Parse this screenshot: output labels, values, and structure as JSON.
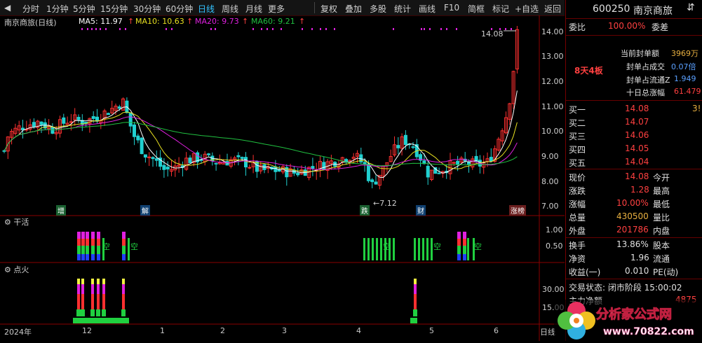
{
  "toolbar": {
    "periods": [
      "分时",
      "1分钟",
      "5分钟",
      "15分钟",
      "30分钟",
      "60分钟",
      "日线",
      "周线",
      "月线",
      "更多"
    ],
    "active_period": "日线",
    "tools": [
      "复权",
      "叠加",
      "多股",
      "统计",
      "画线",
      "F10",
      "简框",
      "标记",
      "+自选",
      "返回"
    ]
  },
  "main_legend": {
    "name": "南京商旅(日线)",
    "ma5": "MA5: 11.97",
    "ma10": "MA10: 10.63",
    "ma20": "MA20: 9.73",
    "ma60": "MA60: 9.21",
    "arrow": "↑"
  },
  "price_axis": [
    "14.00",
    "13.00",
    "12.00",
    "11.00",
    "10.00",
    "9.00",
    "8.00",
    "7.00"
  ],
  "annotations": {
    "high": "14.08",
    "low": "←7.12"
  },
  "event_tags": [
    "增",
    "解",
    "跌",
    "财",
    "涨榜"
  ],
  "panel2": {
    "title": "干活",
    "ticks": [
      "1.00",
      "0.50"
    ],
    "label": "空"
  },
  "panel3": {
    "title": "点火",
    "ticks": [
      "30.00",
      "15.00"
    ]
  },
  "time_axis": {
    "year": "2024年",
    "months": [
      "12",
      "1",
      "2",
      "3",
      "4",
      "5",
      "6"
    ],
    "right_label": "日线"
  },
  "right_panel": {
    "code": "600250",
    "name": "南京商旅",
    "weibi_label": "委比",
    "weibi_value": "100.00%",
    "weicha_label": "委差",
    "streak": "8天4板",
    "seal_amount_label": "当前封单额",
    "seal_amount_value": "3969万",
    "seal_vol_label": "封单占成交",
    "seal_vol_value": "0.07倍",
    "seal_float_label": "封单占流通Z",
    "seal_float_value": "1.949",
    "ten_day_label": "十日总涨幅",
    "ten_day_value": "61.479",
    "bids": [
      {
        "label": "买一",
        "price": "14.08",
        "vol": "3!"
      },
      {
        "label": "买二",
        "price": "14.07",
        "vol": ""
      },
      {
        "label": "买三",
        "price": "14.06",
        "vol": ""
      },
      {
        "label": "买四",
        "price": "14.05",
        "vol": ""
      },
      {
        "label": "买五",
        "price": "14.04",
        "vol": ""
      }
    ],
    "stats": [
      {
        "l1": "现价",
        "v1": "14.08",
        "l2": "今开"
      },
      {
        "l1": "涨跌",
        "v1": "1.28",
        "l2": "最高"
      },
      {
        "l1": "涨幅",
        "v1": "10.00%",
        "l2": "最低"
      },
      {
        "l1": "总量",
        "v1": "430500",
        "l2": "量比"
      },
      {
        "l1": "外盘",
        "v1": "201786",
        "l2": "内盘"
      }
    ],
    "stats2": [
      {
        "l1": "换手",
        "v1": "13.86%",
        "l2": "股本"
      },
      {
        "l1": "净资",
        "v1": "1.96",
        "l2": "流通"
      },
      {
        "l1": "收益(一)",
        "v1": "0.010",
        "l2": "PE(动)"
      }
    ],
    "trade_status": "交易状态: 闭市阶段 15:00:02",
    "main_net": "主力净额",
    "main_net_value": "4875"
  },
  "watermark": {
    "text": "分析家公式网",
    "url": "www.70822.com"
  },
  "colors": {
    "up": "#ff3030",
    "down": "#20d0d0",
    "ma5": "#ffffff",
    "ma10": "#e8e020",
    "ma20": "#e020e0",
    "ma60": "#20c040"
  },
  "chart_data": {
    "type": "candlestick",
    "title": "南京商旅(日线)",
    "ylim": [
      7.0,
      14.3
    ],
    "low": 7.12,
    "high": 14.08,
    "ma": {
      "MA5": 11.97,
      "MA10": 10.63,
      "MA20": 9.73,
      "MA60": 9.21
    },
    "months": [
      "12",
      "1",
      "2",
      "3",
      "4",
      "5",
      "6"
    ]
  }
}
